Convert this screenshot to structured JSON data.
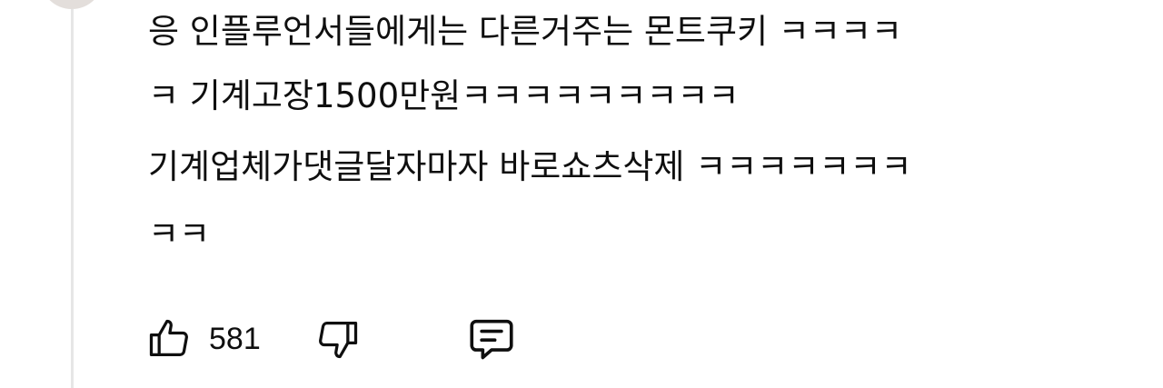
{
  "comment": {
    "lines": [
      "응 인플루언서들에게는 다른거주는 몬트쿠키 ㅋㅋㅋㅋ",
      "ㅋ 기계고장1500만원ㅋㅋㅋㅋㅋㅋㅋㅋㅋ",
      "기계업체가댓글달자마자 바로쇼츠삭제 ㅋㅋㅋㅋㅋㅋㅋ",
      "ㅋㅋ"
    ]
  },
  "actions": {
    "like_count": "581",
    "icons": {
      "like": "thumbs-up-icon",
      "dislike": "thumbs-down-icon",
      "reply": "comment-icon"
    }
  }
}
